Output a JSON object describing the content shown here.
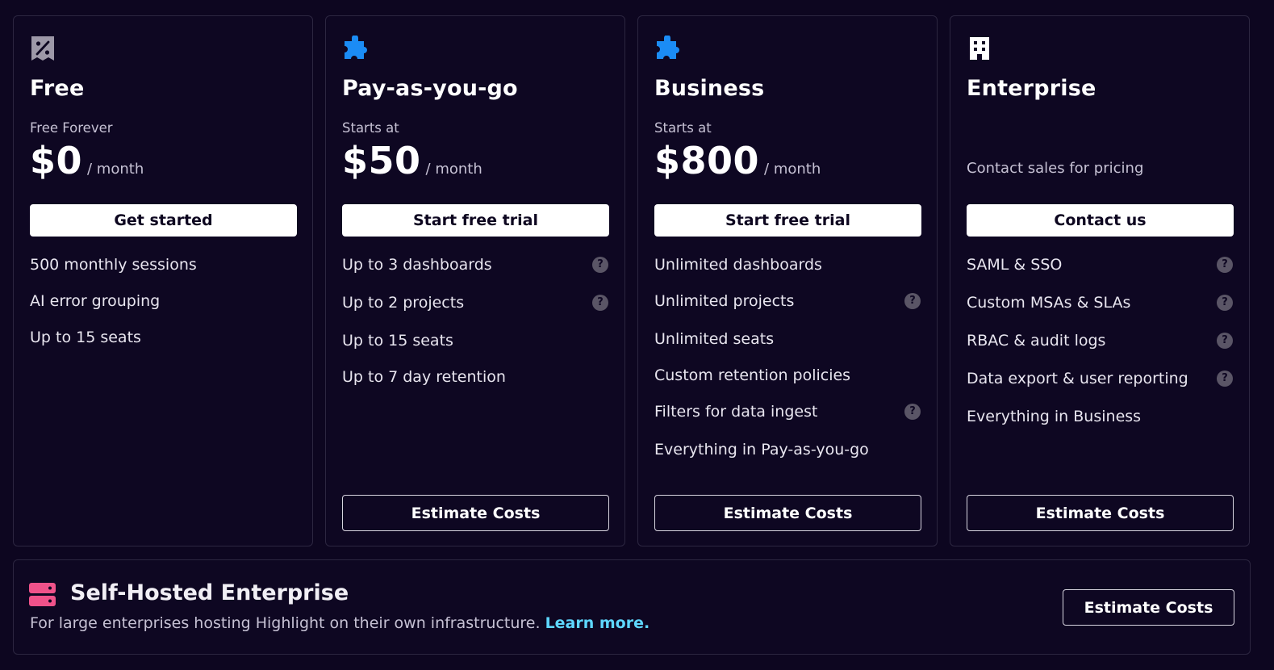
{
  "colors": {
    "background": "#0d0620",
    "card_border": "#2c2640",
    "accent_blue": "#1b8cf5",
    "accent_pink": "#f0528a",
    "link": "#5ed7ff"
  },
  "plans": [
    {
      "icon": "receipt-discount-icon",
      "name": "Free",
      "subline": "Free Forever",
      "price": "$0",
      "per": "/ month",
      "cta": "Get started",
      "features": [
        {
          "text": "500 monthly sessions"
        },
        {
          "text": "AI error grouping"
        },
        {
          "text": "Up to 15 seats"
        }
      ]
    },
    {
      "icon": "puzzle-icon",
      "name": "Pay-as-you-go",
      "subline": "Starts at",
      "price": "$50",
      "per": "/ month",
      "cta": "Start free trial",
      "estimate": "Estimate Costs",
      "features": [
        {
          "text": "Up to 3 dashboards",
          "help": "?"
        },
        {
          "text": "Up to 2 projects",
          "help": "?"
        },
        {
          "text": "Up to 15 seats"
        },
        {
          "text": "Up to 7 day retention"
        }
      ]
    },
    {
      "icon": "puzzle-icon",
      "name": "Business",
      "subline": "Starts at",
      "price": "$800",
      "per": "/ month",
      "cta": "Start free trial",
      "estimate": "Estimate Costs",
      "features": [
        {
          "text": "Unlimited dashboards"
        },
        {
          "text": "Unlimited projects",
          "help": "?"
        },
        {
          "text": "Unlimited seats"
        },
        {
          "text": "Custom retention policies"
        },
        {
          "text": "Filters for data ingest",
          "help": "?"
        },
        {
          "text": "Everything in Pay-as-you-go"
        }
      ]
    },
    {
      "icon": "office-building-icon",
      "name": "Enterprise",
      "contact_note": "Contact sales for pricing",
      "cta": "Contact us",
      "estimate": "Estimate Costs",
      "features": [
        {
          "text": "SAML & SSO",
          "help": "?"
        },
        {
          "text": "Custom MSAs & SLAs",
          "help": "?"
        },
        {
          "text": "RBAC & audit logs",
          "help": "?"
        },
        {
          "text": "Data export & user reporting",
          "help": "?"
        },
        {
          "text": "Everything in Business"
        }
      ]
    }
  ],
  "self_hosted": {
    "icon": "server-icon",
    "title": "Self-Hosted Enterprise",
    "description": "For large enterprises hosting Highlight on their own infrastructure.",
    "link": "Learn more.",
    "cta": "Estimate Costs"
  }
}
